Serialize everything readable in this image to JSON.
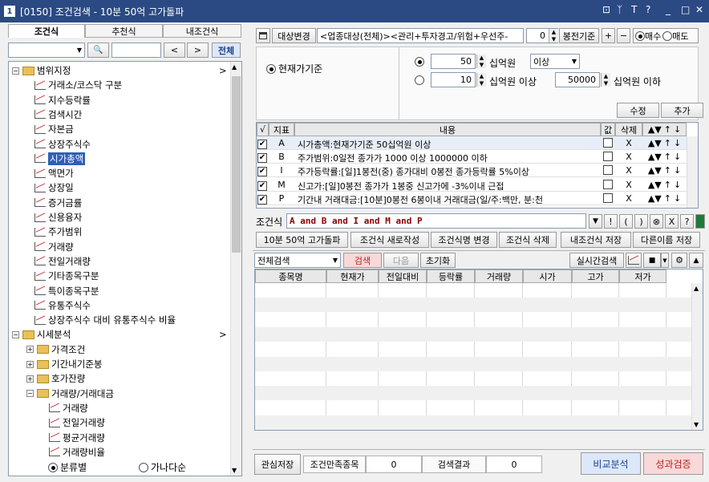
{
  "window": {
    "badge": "1",
    "title": "[0150] 조건검색 - 10분 50억 고가돌파",
    "buttons": [
      "⊡",
      "ᛉ",
      "T",
      "?",
      "_",
      "□",
      "✕"
    ]
  },
  "left": {
    "tabs": [
      "조건식",
      "추천식",
      "내조건식"
    ],
    "search_btn": "🔍",
    "prev": "<",
    "next": ">",
    "all_label": "전체",
    "tree": [
      {
        "label": "범위지정",
        "type": "folder",
        "level": 0,
        "exp": "−",
        "arrow": ">"
      },
      {
        "label": "거래소/코스닥 구분",
        "type": "chart",
        "level": 1
      },
      {
        "label": "지수등락률",
        "type": "chart",
        "level": 1
      },
      {
        "label": "검색시간",
        "type": "chart",
        "level": 1
      },
      {
        "label": "자본금",
        "type": "chart",
        "level": 1
      },
      {
        "label": "상장주식수",
        "type": "chart",
        "level": 1
      },
      {
        "label": "시가총액",
        "type": "chart",
        "level": 1,
        "selected": true
      },
      {
        "label": "액면가",
        "type": "chart",
        "level": 1
      },
      {
        "label": "상장일",
        "type": "chart",
        "level": 1
      },
      {
        "label": "증거금률",
        "type": "chart",
        "level": 1
      },
      {
        "label": "신용융자",
        "type": "chart",
        "level": 1
      },
      {
        "label": "주가범위",
        "type": "chart",
        "level": 1
      },
      {
        "label": "거래량",
        "type": "chart",
        "level": 1
      },
      {
        "label": "전일거래량",
        "type": "chart",
        "level": 1
      },
      {
        "label": "기타종목구분",
        "type": "chart",
        "level": 1
      },
      {
        "label": "특이종목구분",
        "type": "chart",
        "level": 1
      },
      {
        "label": "유통주식수",
        "type": "chart",
        "level": 1
      },
      {
        "label": "상장주식수 대비 유통주식수 비율",
        "type": "chart",
        "level": 1
      },
      {
        "label": "시세분석",
        "type": "folder",
        "level": 0,
        "exp": "−",
        "arrow": ">"
      },
      {
        "label": "가격조건",
        "type": "folder",
        "level": 1,
        "exp": "+"
      },
      {
        "label": "기간내기준봉",
        "type": "folder",
        "level": 1,
        "exp": "+"
      },
      {
        "label": "호가잔량",
        "type": "folder",
        "level": 1,
        "exp": "+"
      },
      {
        "label": "거래량/거래대금",
        "type": "folder",
        "level": 1,
        "exp": "−"
      },
      {
        "label": "거래량",
        "type": "chart",
        "level": 2
      },
      {
        "label": "전일거래량",
        "type": "chart",
        "level": 2
      },
      {
        "label": "평균거래량",
        "type": "chart",
        "level": 2
      },
      {
        "label": "거래량비율",
        "type": "chart",
        "level": 2
      }
    ],
    "radio_category": "분류별",
    "radio_alpha": "가나다순"
  },
  "right": {
    "target_btn": "대상변경",
    "target_text": "<업종대상(전체)><관리+투자경고/위험+우선주-",
    "bong_value": "0",
    "bong_label": "봉전기준",
    "plus": "+",
    "minus": "−",
    "buy": "매수",
    "sell": "매도",
    "criterion": "현재가기준",
    "row1_value": "50",
    "row1_unit": "십억원",
    "row1_select": "이상",
    "row2_value": "10",
    "row2_unit": "십억원 이상",
    "row2_value2": "50000",
    "row2_unit2": "십억원 이하",
    "edit_btn": "수정",
    "add_btn": "추가",
    "cond_headers": {
      "check": "√",
      "index": "지표",
      "content": "내용",
      "value": "값",
      "del": "삭제"
    },
    "conditions": [
      {
        "checked": true,
        "index": "A",
        "text": "시가총액:현재가기준 50십억원 이상",
        "selected": true
      },
      {
        "checked": true,
        "index": "B",
        "text": "주가범위:0일전 종가가 1000 이상 1000000 이하"
      },
      {
        "checked": true,
        "index": "I",
        "text": "주가등락률:[일]1봉전(중) 종가대비 0봉전 종가등락률 5%이상"
      },
      {
        "checked": true,
        "index": "M",
        "text": "신고가:[일]0봉전 종가가 1봉중 신고가에 -3%이내 근접"
      },
      {
        "checked": true,
        "index": "P",
        "text": "기간내 거래대금:[10분]0봉전 6봉이내 거래대금(일/주:백만, 분:천"
      }
    ],
    "del_mark": "X",
    "ctrl_icons": [
      "▲",
      "▼",
      "↑",
      "↓"
    ],
    "formula_label": "조건식",
    "formula": "A and B and I and M and P",
    "formula_btns": [
      "▼",
      "!",
      "(",
      ")",
      "⊗",
      "X",
      "?"
    ],
    "action_btns": [
      "10분 50억 고가돌파",
      "조건식 새로작성",
      "조건식명 변경",
      "조건식 삭제",
      "내조건식 저장",
      "다른이름 저장"
    ],
    "search_select": "전체검색",
    "search_btn": "검색",
    "next_btn": "다음",
    "reset_btn": "초기화",
    "realtime_btn": "실시간검색",
    "result_headers": [
      "종목명",
      "현재가",
      "전일대비",
      "등락률",
      "거래량",
      "시가",
      "고가",
      "저가"
    ],
    "save_interest": "관심저장",
    "count_label": "조건만족종목",
    "count_value": "0",
    "result_label": "검색결과",
    "result_value": "0",
    "compare_btn": "비교분석",
    "verify_btn": "성과검증"
  },
  "colors": {
    "titlebar": "#2b4a84",
    "selection": "#2d5fb8",
    "accent_text": "#8b0000"
  }
}
